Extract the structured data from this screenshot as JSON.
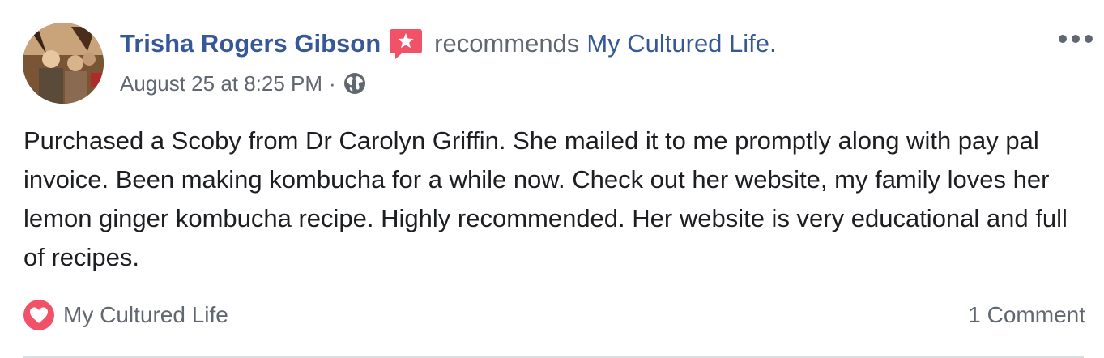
{
  "post": {
    "author": "Trisha Rogers Gibson",
    "verb": "recommends",
    "page_name": "My Cultured Life.",
    "timestamp": "August 25 at 8:25 PM",
    "separator": "·",
    "privacy_icon": "globe-icon",
    "recommend_icon": "star-speech-bubble-icon",
    "body": "Purchased a Scoby from Dr Carolyn Griffin. She mailed it to me promptly along with pay pal invoice. Been making kombucha for a while now. Check out her website, my family loves her lemon ginger kombucha recipe. Highly recommended. Her website is very educational and full of recipes.",
    "footer_page": "My Cultured Life",
    "comment_count": "1 Comment",
    "more_icon": "more-options-icon"
  },
  "colors": {
    "link": "#365899",
    "secondary_text": "#606770",
    "body_text": "#1c1e21",
    "recommend_red": "#f25268",
    "divider": "#dadde1"
  }
}
